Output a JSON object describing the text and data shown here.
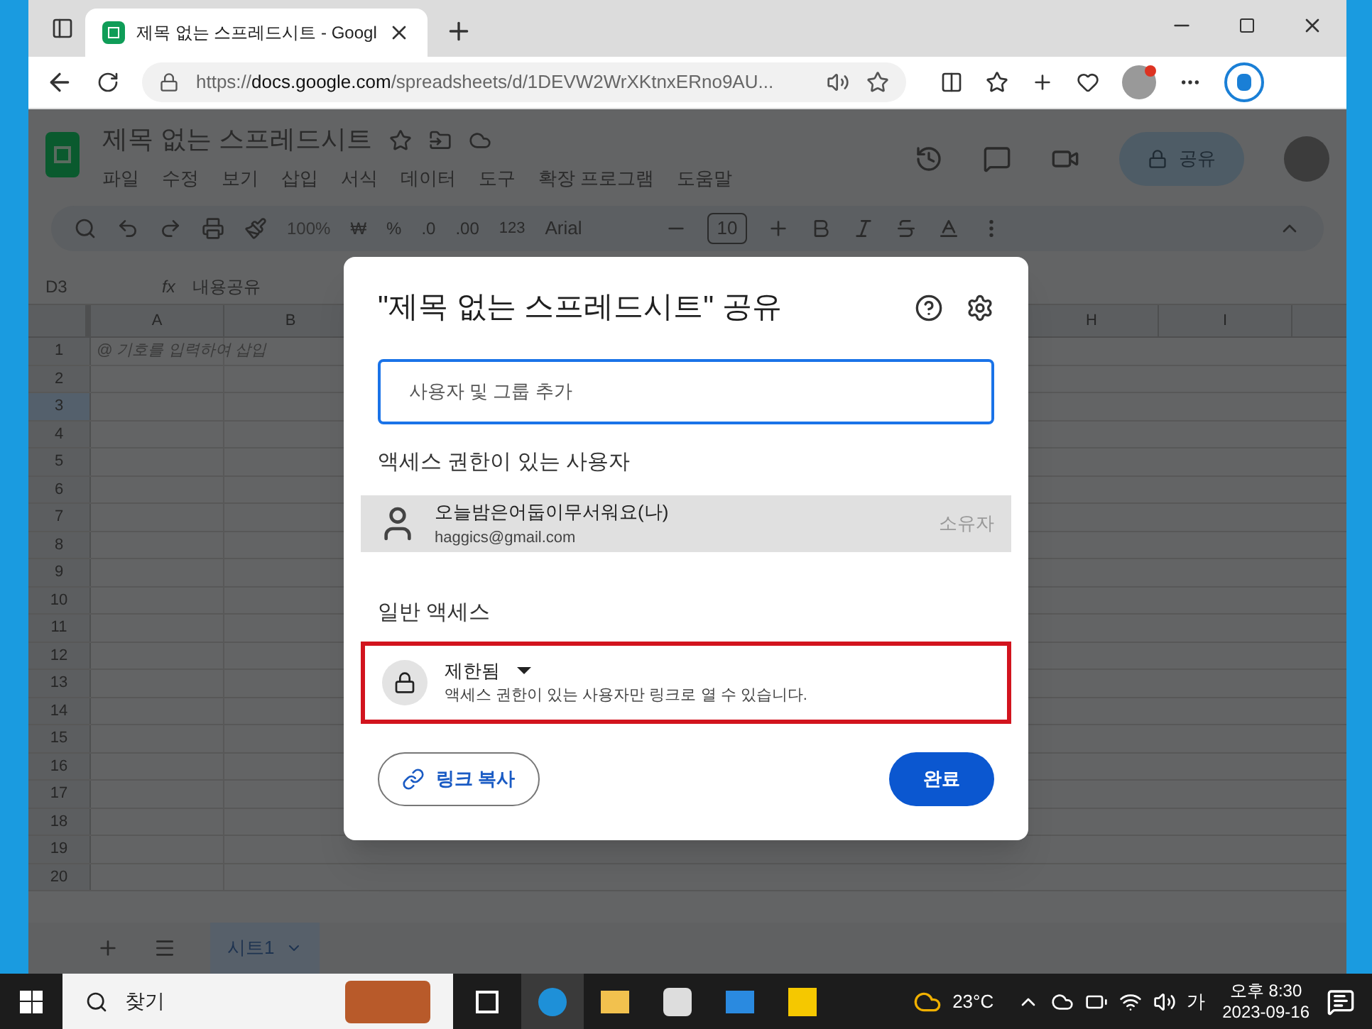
{
  "browser": {
    "tab": {
      "title": "제목 없는 스프레드시트 - Googl",
      "selected": true
    },
    "url": {
      "scheme": "https://",
      "host": "docs.google.com",
      "path": "/spreadsheets/d/1DEVW2WrXKtnxERno9AU..."
    }
  },
  "sheets": {
    "title": "제목 없는 스프레드시트",
    "menus": [
      "파일",
      "수정",
      "보기",
      "삽입",
      "서식",
      "데이터",
      "도구",
      "확장 프로그램",
      "도움말"
    ],
    "share_button": "공유",
    "toolbar": {
      "zoom": "100%",
      "currency": "₩",
      "percent": "%",
      "decrease_decimal": ".0",
      "increase_decimal": ".00",
      "format": "123",
      "font": "Arial",
      "font_size": "10"
    },
    "name_box": "D3",
    "formula_label": "fx",
    "formula": "내용공유",
    "columns": [
      "A",
      "B",
      "H",
      "I"
    ],
    "rows": [
      {
        "label": "1",
        "selected": false,
        "cell_a": "@ 기호를 입력하여 삽입"
      },
      {
        "label": "2",
        "selected": false
      },
      {
        "label": "3",
        "selected": true
      },
      {
        "label": "4",
        "selected": false
      },
      {
        "label": "5",
        "selected": false
      },
      {
        "label": "6",
        "selected": false
      },
      {
        "label": "7",
        "selected": false
      },
      {
        "label": "8",
        "selected": false
      },
      {
        "label": "9",
        "selected": false
      },
      {
        "label": "10",
        "selected": false
      },
      {
        "label": "11",
        "selected": false
      },
      {
        "label": "12",
        "selected": false
      },
      {
        "label": "13",
        "selected": false
      },
      {
        "label": "14",
        "selected": false
      },
      {
        "label": "15",
        "selected": false
      },
      {
        "label": "16",
        "selected": false
      },
      {
        "label": "17",
        "selected": false
      },
      {
        "label": "18",
        "selected": false
      },
      {
        "label": "19",
        "selected": false
      },
      {
        "label": "20",
        "selected": false
      }
    ],
    "sheet_tabs": [
      {
        "label": "시트1",
        "selected": true
      }
    ]
  },
  "dialog": {
    "title": "\"제목 없는 스프레드시트\" 공유",
    "input": {
      "placeholder": "사용자 및 그룹 추가"
    },
    "people_heading": "액세스 권한이 있는 사용자",
    "people": [
      {
        "name": "오늘밤은어둡이무서워요(나)",
        "email": "haggics@gmail.com",
        "role": "소유자"
      }
    ],
    "general_heading": "일반 액세스",
    "general_access": {
      "value": "제한됨",
      "description": "액세스 권한이 있는 사용자만 링크로 열 수 있습니다.",
      "highlighted": true
    },
    "copy_link": "링크 복사",
    "done": "완료"
  },
  "taskbar": {
    "search": "찾기",
    "temperature": "23°C",
    "ime": "가",
    "time": "오후 8:30",
    "date": "2023-09-16"
  }
}
